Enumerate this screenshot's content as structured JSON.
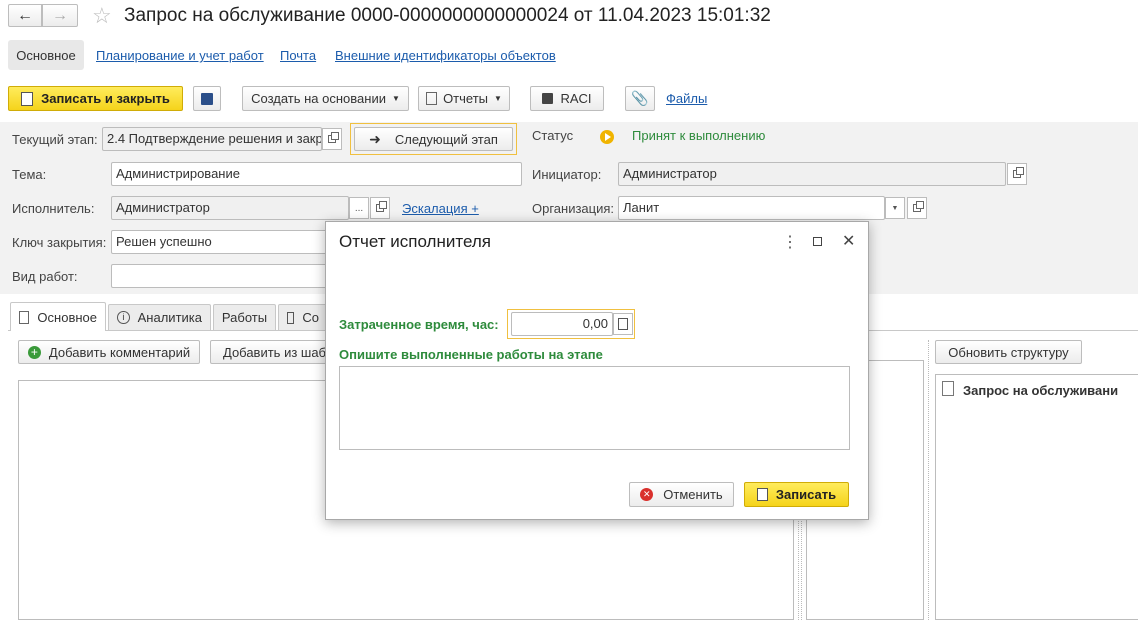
{
  "window": {
    "title": "Запрос на обслуживание 0000-0000000000000024 от 11.04.2023 15:01:32"
  },
  "nav_tabs": [
    {
      "label": "Основное",
      "active": true
    },
    {
      "label": "Планирование и учет работ"
    },
    {
      "label": "Почта"
    },
    {
      "label": "Внешние идентификаторы объектов"
    }
  ],
  "toolbar": {
    "save_close": "Записать и закрыть",
    "create_based": "Создать на основании",
    "reports": "Отчеты",
    "raci": "RACI",
    "files": "Файлы"
  },
  "form": {
    "stage_label": "Текущий этап:",
    "stage_value": "2.4 Подтверждение решения и закр",
    "next_stage": "Следующий этап",
    "status_label": "Статус",
    "status_value": "Принят к выполнению",
    "topic_label": "Тема:",
    "topic_value": "Администрирование",
    "initiator_label": "Инициатор:",
    "initiator_value": "Администратор",
    "executor_label": "Исполнитель:",
    "executor_value": "Администратор",
    "escalation": "Эскалация +",
    "org_label": "Организация:",
    "org_value": "Ланит",
    "close_key_label": "Ключ закрытия:",
    "close_key_value": "Решен успешно",
    "work_type_label": "Вид работ:",
    "work_type_value": ""
  },
  "content_tabs": [
    {
      "label": "Основное",
      "icon": "edit-icon",
      "active": true
    },
    {
      "label": "Аналитика",
      "icon": "info-icon"
    },
    {
      "label": "Работы"
    },
    {
      "label": "Со",
      "icon": "calendar-icon"
    }
  ],
  "content": {
    "add_comment": "Добавить комментарий",
    "add_from_template": "Добавить из шаб",
    "refresh_structure": "Обновить структуру",
    "tree_root": "Запрос на обслуживани"
  },
  "dialog": {
    "title": "Отчет исполнителя",
    "time_label": "Затраченное время, час:",
    "time_value": "0,00",
    "describe_label": "Опишите выполненные работы на этапе",
    "describe_value": "",
    "cancel": "Отменить",
    "save": "Записать"
  },
  "colors": {
    "accent_yellow": "#f5d31b",
    "green_label": "#2e8b3c",
    "link_blue": "#1c5cac",
    "status_orange": "#f0b400"
  }
}
